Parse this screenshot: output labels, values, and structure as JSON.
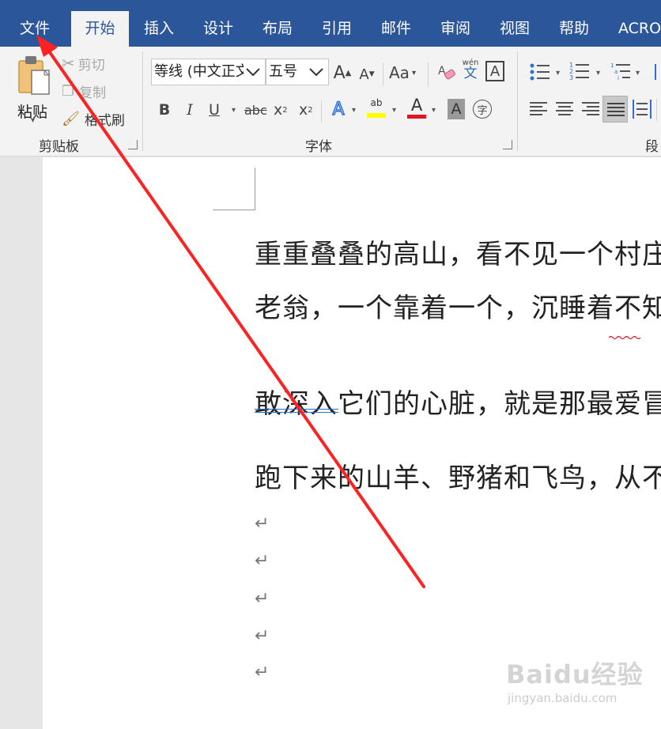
{
  "tabs": [
    "文件",
    "开始",
    "插入",
    "设计",
    "布局",
    "引用",
    "邮件",
    "审阅",
    "视图",
    "帮助",
    "ACRO"
  ],
  "active_tab": "开始",
  "clipboard": {
    "paste_label": "粘贴",
    "cut_label": "剪切",
    "copy_label": "复制",
    "format_painter_label": "格式刷",
    "group_label": "剪贴板"
  },
  "font": {
    "font_name": "等线 (中文正文",
    "font_size": "五号",
    "group_label": "字体",
    "grow_glyph": "A",
    "shrink_glyph": "A",
    "case_glyph": "Aa",
    "phonetic_top": "wén",
    "phonetic_bottom": "文",
    "border_glyph": "A",
    "bold": "B",
    "italic": "I",
    "underline": "U",
    "strike": "abc",
    "subscript": "x",
    "subscript_sub": "2",
    "superscript": "x",
    "superscript_sup": "2",
    "effects": "A",
    "highlight": "ab",
    "font_color": "A",
    "shading": "A",
    "enclose": "字",
    "highlight_color": "#ffff00",
    "font_color_bar": "#e81123"
  },
  "paragraph": {
    "group_label": "段"
  },
  "document": {
    "lines": [
      "重重叠叠的高山，看不见一个村庄",
      "老翁，一个靠着一个，沉睡着不知",
      "敢深入它们的心脏，就是那最爱冒",
      "跑下来的山羊、野猪和飞鸟，从不"
    ],
    "paragraph_mark": "↵"
  },
  "watermark": {
    "logo": "Baidu经验",
    "url": "jingyan.baidu.com"
  },
  "colors": {
    "accent": "#2b579a",
    "annotation_arrow": "#ff2222"
  }
}
